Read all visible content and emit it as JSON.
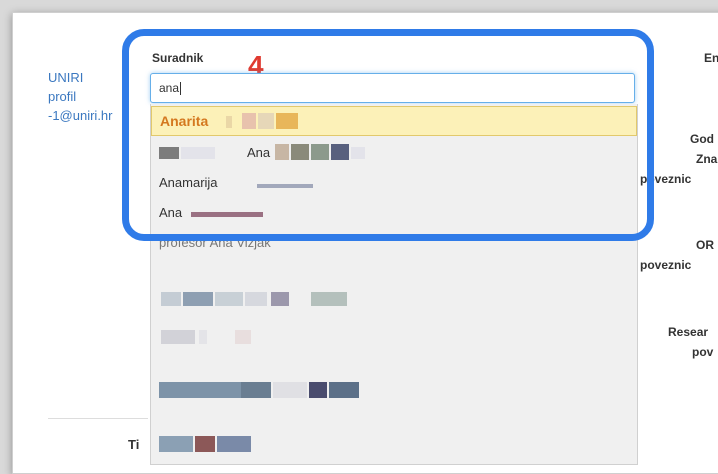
{
  "profile": {
    "line1": "UNIRI",
    "line2": "profil",
    "line3": "-1@uniri.hr"
  },
  "right_column": {
    "t1": "En",
    "t2": "God",
    "t3": "Zna",
    "t4": "poveznic",
    "t5": "OR",
    "t6": "poveznic",
    "t7": "Resear",
    "t8": "pov"
  },
  "field": {
    "label": "Suradnik",
    "value": "ana",
    "step_number": "4"
  },
  "dropdown": {
    "options": [
      "Anarita",
      "Ana",
      "Anamarija",
      "Ana",
      "profesor Ana Vizjak"
    ]
  },
  "bottom": {
    "label": "Ti"
  },
  "colors": {
    "accent_frame": "#2f7be8",
    "step_number": "#e03a30",
    "link": "#3b78c0",
    "highlight_row": "#fcf1b8"
  }
}
